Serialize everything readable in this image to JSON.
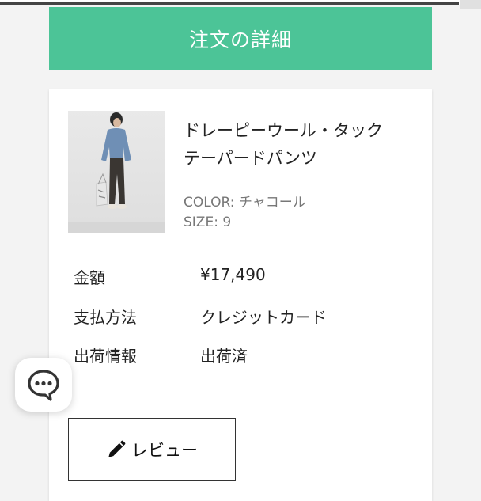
{
  "header": {
    "title": "注文の詳細"
  },
  "order_item": {
    "product_name_line1": "ドレーピーウール・タック",
    "product_name_line2": "テーパードパンツ",
    "color": "COLOR: チャコール",
    "size": "SIZE: 9"
  },
  "details": [
    {
      "label": "金額",
      "value": "¥17,490"
    },
    {
      "label": "支払方法",
      "value": "クレジットカード"
    },
    {
      "label": "出荷情報",
      "value": "出荷済"
    }
  ],
  "review_button": {
    "label": "レビュー",
    "icon": "pencil-icon"
  },
  "chat_button": {
    "icon": "chat-icon"
  },
  "colors": {
    "header_bg": "#4cc497",
    "page_bg": "#f3f3f3",
    "card_bg": "#ffffff"
  }
}
